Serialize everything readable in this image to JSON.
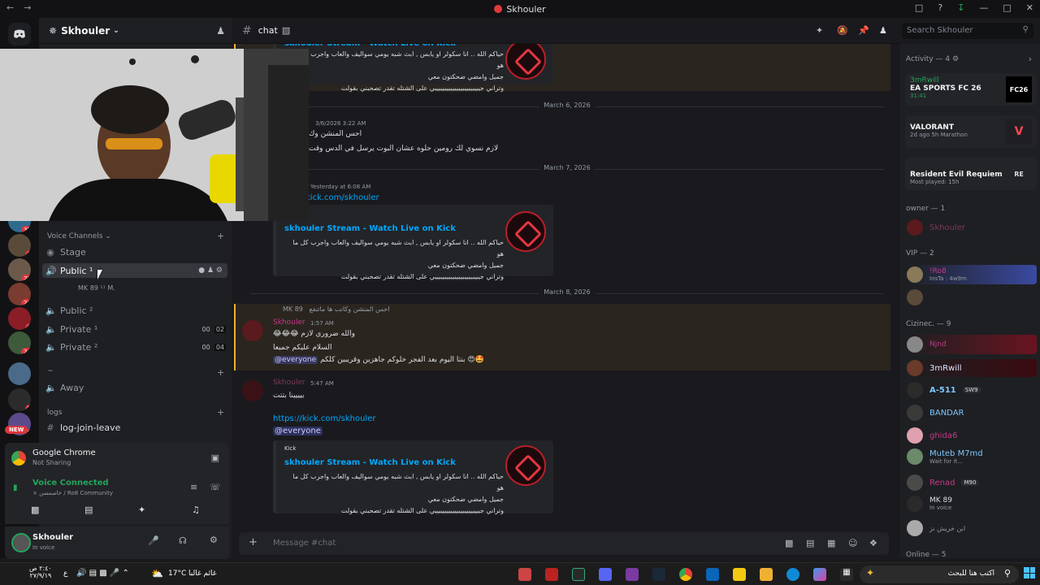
{
  "window": {
    "title": "Skhouler"
  },
  "server": {
    "name": "Skhouler"
  },
  "rail": {
    "badges": [
      "35",
      "1",
      "28",
      "26",
      "1",
      "24",
      "5",
      "1"
    ],
    "new_label": "NEW"
  },
  "channels": {
    "voice_category": "Voice Channels",
    "items": [
      {
        "name": "Stage"
      },
      {
        "name": "Public ¹"
      },
      {
        "name": "Public ²"
      },
      {
        "name": "Private ¹",
        "count_a": "00",
        "count_b": "02"
      },
      {
        "name": "Private ²",
        "count_a": "00",
        "count_b": "04"
      },
      {
        "name": "Away"
      }
    ],
    "voice_user": "MK 89 ¹¹ M.",
    "misc_category": "~",
    "logs_category": "logs",
    "log_channel": "log-join-leave"
  },
  "screenshare": {
    "app": "Google Chrome",
    "status": "Not Sharing"
  },
  "voice": {
    "status": "Voice Connected",
    "location": "× خاصمسن / Ro8 Community"
  },
  "user": {
    "name": "Skhouler",
    "status": "In voice"
  },
  "chat": {
    "channel": "chat",
    "search_placeholder": "Search Skhouler",
    "composer_placeholder": "Message #chat",
    "dates": [
      "March 6, 2026",
      "March 7, 2026",
      "March 8, 2026"
    ],
    "embed": {
      "title": "skhouler Stream - Watch Live on Kick",
      "provider": "Kick",
      "desc_line1": "حياكم الله .. انا سكولر او يابس , ابث شبه يومي سواليف والعاب واجرب كل ما هو",
      "desc_line2": "جميل وامضي ضحكتون معي",
      "desc_line3": "وتراني جيييييييييييييييييييييييي على الشتله تقدر تصحبني بقولت"
    },
    "msg1": {
      "time": "3/6/2026 3:22 AM",
      "line1": "احس المنشن وك",
      "line2": "لازم نسوي لك رومين حلوه عشان البوت يرسل في الدس وقت"
    },
    "msg2": {
      "time": "Yesterday at 6:08 AM",
      "link": "kick.com/skhouler"
    },
    "msg3": {
      "reply_user": "MK 89",
      "reply_text": "احس المنشن وكاتب ها ماتنفع",
      "author": "Skhouler",
      "time": "1:57 AM",
      "line1": "والله ضروري لازم 😂😂😂",
      "line2": "السلام عليكم جميعا",
      "mention": "@everyone",
      "line3": "بنتا اليوم بعد الفجر خلوكم جاهزين وقريبين كلكم 😍🤩"
    },
    "msg4": {
      "author": "Skhouler",
      "time": "5:47 AM",
      "line1": "بيييينا بتتت",
      "link": "https://kick.com/skhouler",
      "mention": "@everyone"
    }
  },
  "members": {
    "activity_header": "Activity — 4",
    "activities": [
      {
        "user": "3mRwill",
        "game": "EA SPORTS FC 26",
        "detail": "31:41",
        "tag": "FC26"
      },
      {
        "user": "",
        "game": "VALORANT",
        "detail": "2d ago  5h Marathon",
        "tag": "V"
      },
      {
        "user": "",
        "game": "Resident Evil Requiem",
        "detail": "Most played: 15h",
        "tag": "RE"
      }
    ],
    "owner_header": "owner — 1",
    "owner": "Skhouler",
    "vip_header": "VIP — 2",
    "vip": [
      {
        "name": "!Ro8",
        "sub": "InsTa : 4w9m"
      },
      {
        "name": "",
        "sub": ""
      }
    ],
    "cizinec_header": "Cizinec. — 9",
    "cizinec": [
      {
        "name": "Njnd",
        "sub": "",
        "color": "#c43a8a"
      },
      {
        "name": "3mRwill",
        "sub": "",
        "color": "#e0e4ff"
      },
      {
        "name": "A-511",
        "sub": "SW9",
        "color": "#7dc6ff"
      },
      {
        "name": "BANDAR",
        "sub": "",
        "color": "#7dc6ff"
      },
      {
        "name": "ghida6",
        "sub": "",
        "color": "#c43a8a"
      },
      {
        "name": "Muteb M7md",
        "sub": "Wait for it...",
        "color": "#7dc6ff"
      },
      {
        "name": "Renad",
        "sub": "M90",
        "color": "#c43a8a"
      },
      {
        "name": "MK 89",
        "sub": "In voice",
        "color": "#dbdee1"
      },
      {
        "name": "ابن خريش نز",
        "sub": "",
        "color": "#949ba4"
      }
    ],
    "online_header": "Online — 5"
  },
  "taskbar": {
    "time": "٢:٤٠ ص",
    "date": "٢٧/٩/١٩",
    "weather": "17°C",
    "weather_text": "غائم غالبا",
    "lang": "ع",
    "search": "اكتب هنا للبحث"
  },
  "colors": {
    "accent": "#5865f2",
    "mention": "#f0b132",
    "link": "#00a8fc",
    "kick": "#e23740"
  }
}
